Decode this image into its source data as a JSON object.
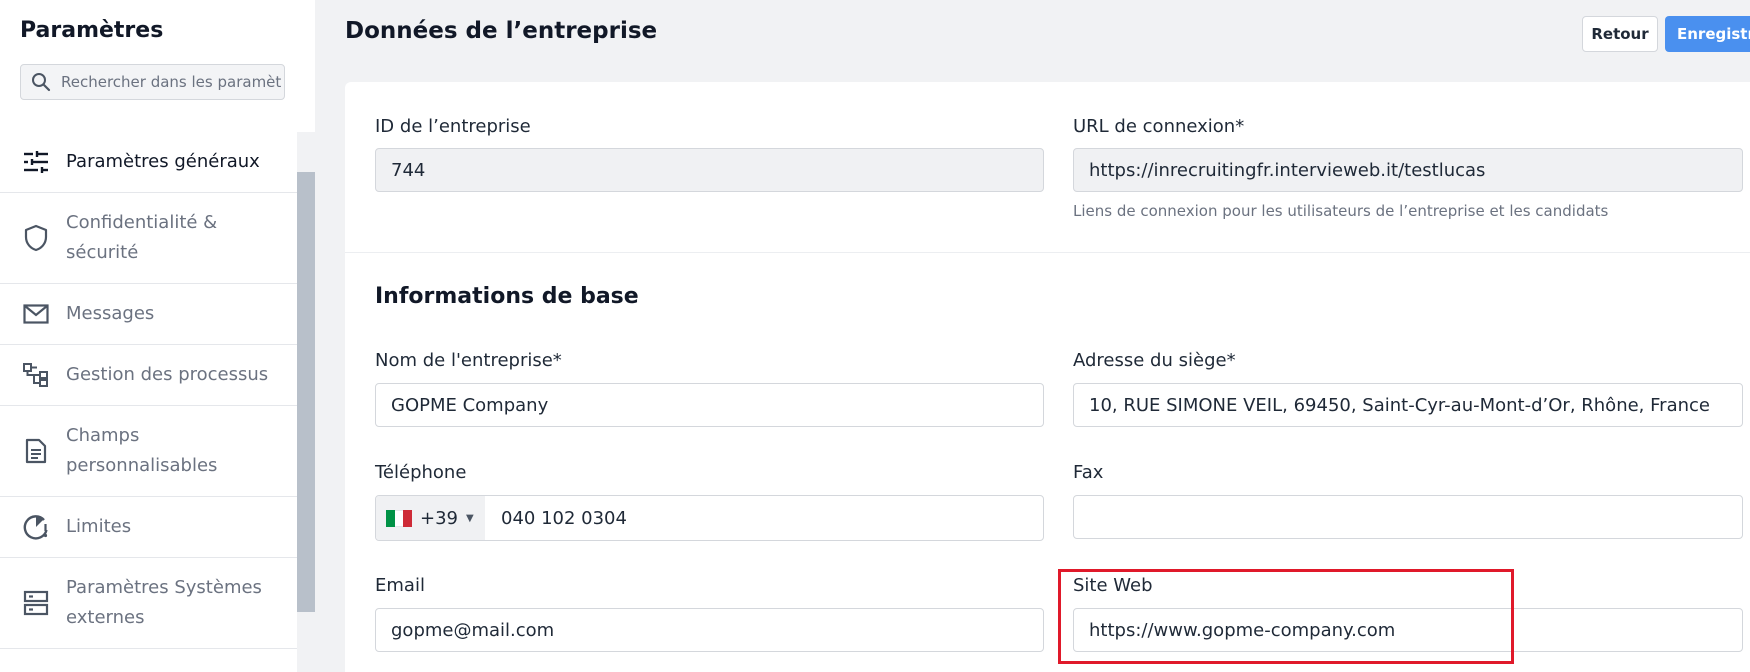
{
  "sidebar": {
    "title": "Paramètres",
    "search_placeholder": "Rechercher dans les paramètres",
    "items": [
      {
        "label": "Paramètres généraux",
        "icon": "sliders-icon",
        "active": true
      },
      {
        "label": "Confidentialité & sécurité",
        "icon": "shield-icon"
      },
      {
        "label": "Messages",
        "icon": "mail-icon"
      },
      {
        "label": "Gestion des processus",
        "icon": "workflow-icon"
      },
      {
        "label": "Champs personnalisables",
        "icon": "document-icon"
      },
      {
        "label": "Limites",
        "icon": "gauge-icon"
      },
      {
        "label": "Paramètres Systèmes externes",
        "icon": "server-icon"
      }
    ]
  },
  "header": {
    "title": "Données de l’entreprise",
    "back_label": "Retour",
    "save_label": "Enregistrer"
  },
  "company": {
    "id_label": "ID de l’entreprise",
    "id_value": "744",
    "url_label": "URL de connexion*",
    "url_value": "https://inrecruitingfr.intervieweb.it/testlucas",
    "url_hint": "Liens de connexion pour les utilisateurs de l’entreprise et les candidats"
  },
  "basic": {
    "section_title": "Informations de base",
    "name_label": "Nom de l'entreprise*",
    "name_value": "GOPME Company",
    "address_label": "Adresse du siège*",
    "address_value": "10, RUE SIMONE VEIL, 69450, Saint-Cyr-au-Mont-d’Or, Rhône, France",
    "phone_label": "Téléphone",
    "phone_country_code": "+39",
    "phone_flag_colors": [
      "#009246",
      "#ffffff",
      "#ce2b37"
    ],
    "phone_value": "040 102 0304",
    "fax_label": "Fax",
    "fax_value": "",
    "email_label": "Email",
    "email_value": "gopme@mail.com",
    "website_label": "Site Web",
    "website_value": "https://www.gopme-company.com"
  },
  "colors": {
    "accent": "#4a90ef",
    "highlight": "#e0192a"
  }
}
